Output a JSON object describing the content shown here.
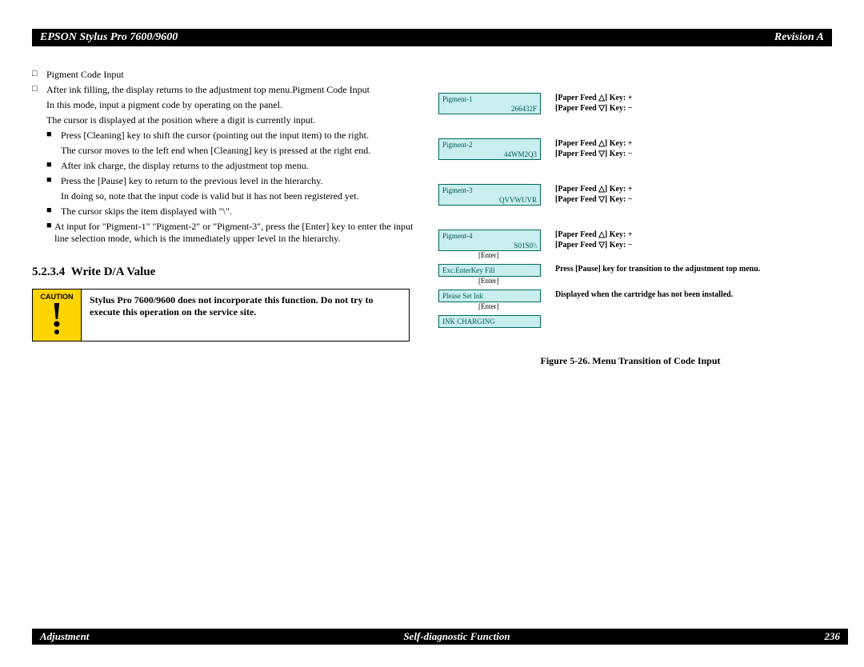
{
  "header": {
    "title_left": "EPSON Stylus Pro 7600/9600",
    "title_right": "Revision A"
  },
  "footer": {
    "left": "Adjustment",
    "center": "Self-diagnostic Function",
    "right": "236"
  },
  "left": {
    "b1": "Pigment Code Input",
    "b2": "After ink filling, the display returns to the adjustment top menu.Pigment Code Input",
    "b2a": "In this mode, input a pigment code by operating on the panel.",
    "b2b": "The cursor is displayed at the position where a digit is currently input.",
    "s1": "Press [Cleaning] key to shift the cursor (pointing out the input item) to the right.",
    "s1a": "The cursor moves to the left end when [Cleaning] key is pressed at the right end.",
    "s2": "After ink charge, the display returns to the adjustment top menu.",
    "s3": "Press the [Pause] key to return to the previous level in the hierarchy.",
    "s3a": "In doing so, note that the input code is valid but it has not been registered yet.",
    "s4": "The cursor skips the item displayed with \"\\\".",
    "s5": "At input for \"Pigment-1\" \"Pigment-2\" or \"Pigment-3\", press the [Enter] key to enter the input line selection mode, which is the immediately upper level in the hierarchy.",
    "heading_num": "5.2.3.4",
    "heading_txt": "Write D/A Value",
    "caution_label": "CAUTION",
    "caution_text": "Stylus Pro 7600/9600 does not incorporate this function. Do not try to execute this operation on the service site."
  },
  "diag": {
    "p1_label": "Pigment-1",
    "p1_val": "266432F",
    "p2_label": "Pigment-2",
    "p2_val": "44WM2Q3",
    "p3_label": "Pigment-3",
    "p3_val": "QVVWUVR",
    "p4_label": "Pigment-4",
    "p4_val": "S01S0\\\\",
    "exc": "Exc.EnterKey Fill",
    "please": "Please Set Ink",
    "charging": "INK CHARGING",
    "enter": "[Enter]",
    "side_up": "[Paper Feed △] Key: +",
    "side_dn": "[Paper Feed ▽] Key: −",
    "side_pause": "Press [Pause] key for transition to the adjustment top menu.",
    "side_cart": "Displayed when the cartridge has not been installed.",
    "fig": "Figure 5-26.  Menu Transition of Code Input"
  }
}
